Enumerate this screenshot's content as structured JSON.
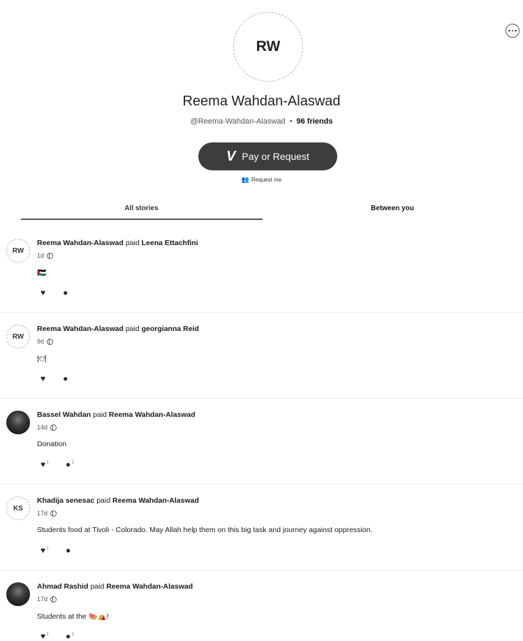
{
  "profile": {
    "initials": "RW",
    "name": "Reema Wahdan-Alaswad",
    "username": "@Reema-Wahdan-Alaswad",
    "separator": "•",
    "friends": "96 friends",
    "pay_button_label": "Pay or Request",
    "pay_icon": "V",
    "request_link_label": "Request me"
  },
  "more_button": {
    "icon": "more-horizontal-icon"
  },
  "tabs": [
    {
      "label": "All stories",
      "active": true
    },
    {
      "label": "Between you",
      "active": false
    }
  ],
  "stories": [
    {
      "avatar": "RW",
      "avatar_kind": "initials",
      "actor": "Reema Wahdan-Alaswad",
      "verb": "paid",
      "target": "Leena Ettachfini",
      "time": "1d",
      "note": "🇵🇸",
      "likes": "",
      "comments": ""
    },
    {
      "avatar": "RW",
      "avatar_kind": "initials",
      "actor": "Reema Wahdan-Alaswad",
      "verb": "paid",
      "target": "georgianna Reid",
      "time": "9d",
      "note": "🍽",
      "likes": "",
      "comments": ""
    },
    {
      "avatar": "",
      "avatar_kind": "photo",
      "actor": "Bassel Wahdan",
      "verb": "paid",
      "target": "Reema Wahdan-Alaswad",
      "time": "14d",
      "note": "Donation",
      "likes": "1",
      "comments": "1"
    },
    {
      "avatar": "KS",
      "avatar_kind": "initials",
      "actor": "Khadija senesac",
      "verb": "paid",
      "target": "Reema Wahdan-Alaswad",
      "time": "17d",
      "note": "Students food at Tivoli - Colorado. May Allah help them on this big task and journey against oppression.",
      "likes": "1",
      "comments": ""
    },
    {
      "avatar": "",
      "avatar_kind": "photo",
      "actor": "Ahmad Rashid",
      "verb": "paid",
      "target": "Reema Wahdan-Alaswad",
      "time": "17d",
      "note": "Students at the 🍉⛺!",
      "likes": "1",
      "comments": "1"
    }
  ],
  "colors": {
    "button_bg": "#3d3d3d",
    "text": "#1a1a1a",
    "divider": "#eeeeee"
  }
}
